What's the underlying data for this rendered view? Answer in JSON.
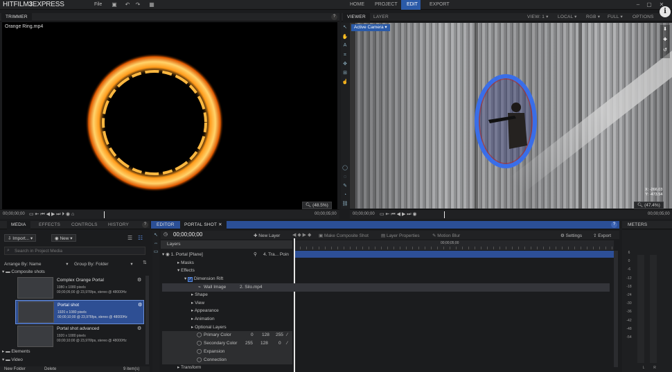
{
  "app": {
    "logo_prefix": "HITFILM",
    "logo_num": "3",
    "logo_suffix": "EXPRESS",
    "file_menu": "File"
  },
  "nav_tabs": [
    "HOME",
    "PROJECT",
    "EDIT",
    "EXPORT"
  ],
  "nav_active": "EDIT",
  "trimmer": {
    "tab": "TRIMMER",
    "clip_name": "Orange Ring.mp4",
    "tc_left": "00;00;00;00",
    "tc_right": "00;00;05;00",
    "zoom": "(48.5%)"
  },
  "viewer": {
    "tabs": [
      "VIEWER",
      "LAYER"
    ],
    "camera": "Active Camera",
    "view_select": "VIEW: 1",
    "local_select": "LOCAL",
    "rgb_select": "RGB",
    "full_select": "FULL",
    "options": "OPTIONS",
    "tc_left": "00;00;00;00",
    "tc_right": "00;00;05;00",
    "zoom": "(47.4%)",
    "coord_x": "X: -266.03",
    "coord_y": "Y: -473.54"
  },
  "media": {
    "tabs": [
      "MEDIA",
      "EFFECTS",
      "CONTROLS",
      "HISTORY"
    ],
    "import_btn": "Import...",
    "new_btn": "New",
    "search_placeholder": "Search in Project Media",
    "arrange": "Arrange By: Name",
    "group": "Group By: Folder",
    "folder_composite": "Composite shots",
    "items": [
      {
        "title": "Complex Orange Portal",
        "line1": "1080 x 1080 pixels",
        "line2": "00;00;05;00 @ 23,976fps, stereo @ 48000Hz"
      },
      {
        "title": "Portal shot",
        "line1": "1920 x 1080 pixels",
        "line2": "00;00;10;00 @ 23,976fps, stereo @ 48000Hz"
      },
      {
        "title": "Portal shot advanced",
        "line1": "1920 x 1080 pixels",
        "line2": "00;00;10;00 @ 23,976fps, stereo @ 48000Hz"
      }
    ],
    "folder_elements": "Elements",
    "folder_video": "Video",
    "new_folder": "New Folder",
    "delete": "Delete",
    "count": "9 item(s)"
  },
  "editor": {
    "tabs": [
      "EDITOR",
      "PORTAL SHOT"
    ],
    "timecode": "00;00;00;00",
    "new_layer": "New Layer",
    "make_composite": "Make Composite Shot",
    "layer_props": "Layer Properties",
    "motion_blur": "Motion Blur",
    "settings": "Settings",
    "export": "Export",
    "layers_hdr": "Layers",
    "ruler_mark": "00;00;05;00",
    "layer1": "1. Portal [Plane]",
    "layer1_parent": "4. Tra... Poin",
    "masks": "Masks",
    "effects": "Effects",
    "dimension_rift": "Dimension Rift",
    "wall_image": "Wall Image",
    "wall_value": "2. Silo.mp4",
    "shape": "Shape",
    "view": "View",
    "appearance": "Appearance",
    "animation": "Animation",
    "optional": "Optional Layers",
    "primary_color": "Primary Color",
    "primary_vals": [
      "0",
      "128",
      "255"
    ],
    "secondary_color": "Secondary Color",
    "secondary_vals": [
      "255",
      "128",
      "0"
    ],
    "expansion": "Expansion",
    "connection": "Connection",
    "transform": "Transform"
  },
  "meters": {
    "title": "METERS",
    "scale": [
      "6",
      "0",
      "-6",
      "-12",
      "-18",
      "-24",
      "-30",
      "-36",
      "-42",
      "-48",
      "-54"
    ],
    "left": "L",
    "right": "R"
  },
  "colors": {
    "accent": "#2a5aa8",
    "panel": "#1b1c1e"
  }
}
